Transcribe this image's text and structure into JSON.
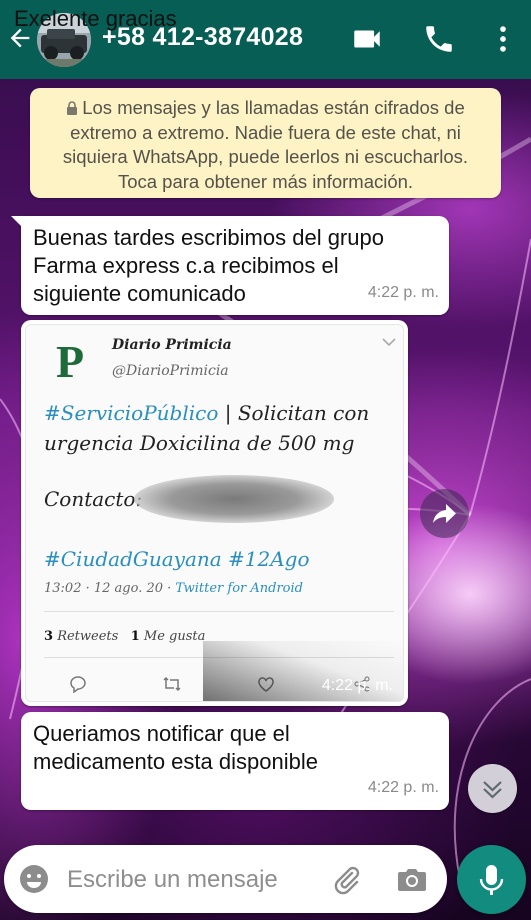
{
  "header": {
    "title": "+58 412-3874028",
    "back_icon": "arrow-left-icon",
    "video_icon": "video-call-icon",
    "call_icon": "phone-icon",
    "menu_icon": "more-vert-icon",
    "bg_color": "#075e54"
  },
  "notice": {
    "lines": [
      "Los mensajes y las llamadas están cifrados de",
      "extremo a extremo. Nadie fuera de este chat, ni",
      "siquiera WhatsApp, puede leerlos ni escucharlos.",
      "Toca para obtener más información."
    ]
  },
  "messages": [
    {
      "lines": [
        "Buenas tardes escribimos del grupo",
        "Farma express c.a recibimos el",
        "siguiente comunicado"
      ],
      "time": "4:22 p. m."
    },
    {
      "type": "image",
      "time": "4:22 p. m.",
      "tweet": {
        "logo_letter": "P",
        "name": "Diario Primicia",
        "handle": "@DiarioPrimicia",
        "hashtag1": "#ServicioPúblico",
        "text1_rest": " | Solicitan con",
        "text2": "urgencia Doxicilina de 500 mg",
        "contact_label": "Contacto:",
        "hashtags2": "#CiudadGuayana #12Ago",
        "meta_time": "13:02 · 12 ago. 20 · ",
        "meta_source": "Twitter for Android",
        "retweets_count": "3",
        "retweets_label": "Retweets",
        "likes_count": "1",
        "likes_label": "Me gusta"
      }
    },
    {
      "lines": [
        "Queriamos notificar que el",
        "medicamento esta disponible"
      ],
      "time": "4:22 p. m."
    },
    {
      "type": "outgoing-partial",
      "text": "Exelente gracias"
    }
  ],
  "composer": {
    "placeholder": "Escribe un mensaje",
    "emoji_icon": "emoji-icon",
    "attach_icon": "paperclip-icon",
    "camera_icon": "camera-icon",
    "mic_icon": "microphone-icon"
  },
  "colors": {
    "notice_bg": "#fdf3c5",
    "outgoing_bg": "#dcf8c6",
    "mic_bg": "#128c7e",
    "hashtag": "#2a8fbf"
  }
}
